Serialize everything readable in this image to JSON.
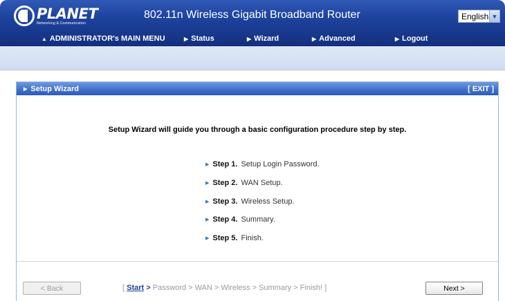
{
  "header": {
    "logo": {
      "name": "PLANET",
      "tagline": "Networking & Communication"
    },
    "product_title": "802.11n Wireless Gigabit Broadband Router",
    "language": {
      "selected": "English"
    }
  },
  "menu": {
    "items": [
      {
        "label": "ADMINISTRATOR's MAIN MENU",
        "icon": "user-icon"
      },
      {
        "label": "Status",
        "icon": "arrow-right-icon"
      },
      {
        "label": "Wizard",
        "icon": "arrow-right-icon"
      },
      {
        "label": "Advanced",
        "icon": "arrow-right-icon"
      },
      {
        "label": "Logout",
        "icon": "arrow-right-icon"
      }
    ]
  },
  "panel": {
    "title": "Setup Wizard",
    "exit_label": "[ EXIT ]",
    "intro": "Setup Wizard will guide you through a basic configuration procedure step by step.",
    "steps": [
      {
        "num": "Step 1.",
        "text": "Setup Login Password."
      },
      {
        "num": "Step 2.",
        "text": "WAN Setup."
      },
      {
        "num": "Step 3.",
        "text": "Wireless Setup."
      },
      {
        "num": "Step 4.",
        "text": "Summary."
      },
      {
        "num": "Step 5.",
        "text": "Finish."
      }
    ]
  },
  "footer": {
    "back_label": "< Back",
    "next_label": "Next >",
    "progress": {
      "open": "[ ",
      "current": "Start",
      "sep": " > ",
      "rest": "Password > WAN > Wireless > Summary > Finish! ]"
    }
  }
}
